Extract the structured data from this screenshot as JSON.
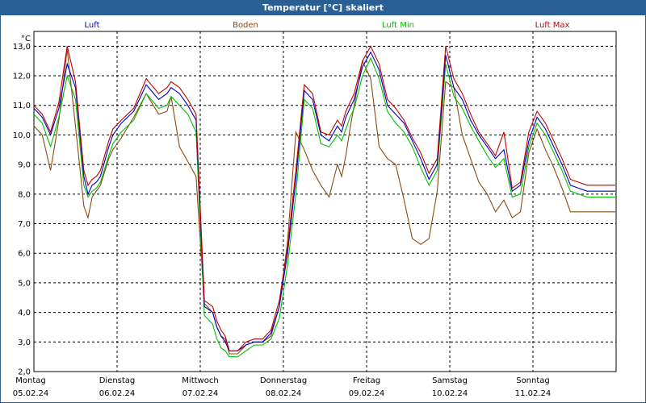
{
  "window": {
    "title": "Temperatur [°C] skaliert"
  },
  "colors": {
    "luft": "#0000c8",
    "boden": "#8b4a10",
    "luft_min": "#00c000",
    "luft_max": "#c00000",
    "titlebar": "#2a5f96",
    "grid": "#000000"
  },
  "chart_data": {
    "type": "line",
    "title": "Temperatur [°C] skaliert",
    "ylabel": "°C",
    "ylim": [
      2.0,
      13.5
    ],
    "yticks": [
      "2,0",
      "3,0",
      "4,0",
      "5,0",
      "6,0",
      "7,0",
      "8,0",
      "9,0",
      "10,0",
      "11,0",
      "12,0",
      "13,0"
    ],
    "x_unit": "days since Montag 05.02.24 00:00",
    "xlim": [
      0,
      7
    ],
    "x_ticks": [
      {
        "day": "Montag",
        "date": "05.02.24"
      },
      {
        "day": "Dienstag",
        "date": "06.02.24"
      },
      {
        "day": "Mittwoch",
        "date": "07.02.24"
      },
      {
        "day": "Donnerstag",
        "date": "08.02.24"
      },
      {
        "day": "Freitag",
        "date": "09.02.24"
      },
      {
        "day": "Samstag",
        "date": "10.02.24"
      },
      {
        "day": "Sonntag",
        "date": "11.02.24"
      }
    ],
    "grid": true,
    "legend": "top",
    "series": [
      {
        "name": "Luft",
        "x": [
          0,
          0.1,
          0.2,
          0.3,
          0.4,
          0.5,
          0.6,
          0.65,
          0.7,
          0.75,
          0.8,
          0.9,
          0.95,
          1.05,
          1.2,
          1.35,
          1.5,
          1.6,
          1.65,
          1.75,
          1.85,
          1.95,
          2.05,
          2.15,
          2.2,
          2.25,
          2.3,
          2.35,
          2.45,
          2.55,
          2.65,
          2.75,
          2.85,
          2.95,
          3.05,
          3.15,
          3.25,
          3.35,
          3.45,
          3.55,
          3.65,
          3.7,
          3.75,
          3.8,
          3.85,
          3.95,
          4.05,
          4.15,
          4.25,
          4.35,
          4.45,
          4.55,
          4.65,
          4.75,
          4.85,
          4.95,
          5.05,
          5.15,
          5.25,
          5.35,
          5.45,
          5.55,
          5.65,
          5.75,
          5.85,
          5.95,
          6.05,
          6.15,
          6.25,
          6.35,
          6.45,
          6.55,
          6.65,
          6.75,
          6.85,
          6.95,
          6.99
        ],
        "values": [
          10.9,
          10.6,
          10.0,
          10.9,
          12.4,
          11.6,
          8.6,
          8.0,
          8.3,
          8.4,
          8.6,
          9.6,
          10.0,
          10.4,
          10.8,
          11.7,
          11.2,
          11.4,
          11.6,
          11.4,
          11.0,
          10.5,
          4.2,
          4.0,
          3.5,
          3.2,
          3.0,
          2.7,
          2.7,
          2.9,
          3.0,
          3.0,
          3.3,
          4.2,
          6.0,
          8.5,
          11.5,
          11.2,
          10.0,
          9.8,
          10.3,
          10.1,
          10.6,
          10.9,
          11.2,
          12.3,
          12.8,
          12.2,
          11.0,
          10.7,
          10.4,
          9.8,
          9.2,
          8.5,
          9.0,
          12.7,
          11.6,
          11.2,
          10.5,
          10.0,
          9.6,
          9.2,
          9.5,
          8.1,
          8.3,
          9.8,
          10.6,
          10.2,
          9.6,
          9.0,
          8.3,
          8.2,
          8.1,
          8.1,
          8.1,
          8.1,
          8.1
        ]
      },
      {
        "name": "Boden",
        "x": [
          0,
          0.1,
          0.2,
          0.3,
          0.4,
          0.5,
          0.6,
          0.65,
          0.7,
          0.75,
          0.8,
          0.9,
          0.95,
          1.05,
          1.2,
          1.35,
          1.5,
          1.6,
          1.65,
          1.75,
          1.85,
          1.95,
          2.05,
          2.15,
          2.2,
          2.25,
          2.3,
          2.35,
          2.45,
          2.55,
          2.65,
          2.75,
          2.85,
          2.95,
          3.05,
          3.15,
          3.25,
          3.35,
          3.45,
          3.55,
          3.65,
          3.7,
          3.75,
          3.8,
          3.85,
          3.95,
          4.05,
          4.15,
          4.25,
          4.35,
          4.45,
          4.55,
          4.65,
          4.75,
          4.85,
          4.95,
          5.05,
          5.15,
          5.25,
          5.35,
          5.45,
          5.55,
          5.65,
          5.75,
          5.85,
          5.95,
          6.05,
          6.15,
          6.25,
          6.35,
          6.45,
          6.55,
          6.65,
          6.75,
          6.85,
          6.95,
          6.99
        ],
        "values": [
          10.3,
          10.0,
          8.8,
          10.5,
          12.9,
          10.3,
          7.6,
          7.2,
          7.9,
          8.1,
          8.3,
          9.2,
          9.5,
          9.9,
          10.6,
          11.4,
          10.7,
          10.8,
          11.3,
          9.6,
          9.1,
          8.6,
          4.3,
          4.0,
          3.5,
          3.2,
          3.1,
          2.6,
          2.6,
          2.9,
          3.0,
          3.0,
          3.2,
          4.2,
          6.4,
          10.1,
          9.5,
          8.8,
          8.3,
          7.9,
          9.0,
          8.6,
          9.3,
          10.2,
          11.0,
          12.5,
          11.9,
          9.6,
          9.2,
          9.0,
          7.8,
          6.5,
          6.3,
          6.5,
          8.1,
          11.8,
          11.6,
          10.0,
          9.2,
          8.4,
          8.0,
          7.4,
          7.8,
          7.2,
          7.4,
          9.4,
          10.2,
          9.5,
          8.9,
          8.2,
          7.4,
          7.4,
          7.4,
          7.4,
          7.4,
          7.4,
          7.4
        ]
      },
      {
        "name": "Luft Min",
        "x": [
          0,
          0.1,
          0.2,
          0.3,
          0.4,
          0.5,
          0.6,
          0.65,
          0.7,
          0.75,
          0.8,
          0.9,
          0.95,
          1.05,
          1.2,
          1.35,
          1.5,
          1.6,
          1.65,
          1.75,
          1.85,
          1.95,
          2.05,
          2.15,
          2.2,
          2.25,
          2.3,
          2.35,
          2.45,
          2.55,
          2.65,
          2.75,
          2.85,
          2.95,
          3.05,
          3.15,
          3.25,
          3.35,
          3.45,
          3.55,
          3.65,
          3.7,
          3.75,
          3.8,
          3.85,
          3.95,
          4.05,
          4.15,
          4.25,
          4.35,
          4.45,
          4.55,
          4.65,
          4.75,
          4.85,
          4.95,
          5.05,
          5.15,
          5.25,
          5.35,
          5.45,
          5.55,
          5.65,
          5.75,
          5.85,
          5.95,
          6.05,
          6.15,
          6.25,
          6.35,
          6.45,
          6.55,
          6.65,
          6.75,
          6.85,
          6.95,
          6.99
        ],
        "values": [
          10.7,
          10.4,
          9.6,
          10.6,
          12.0,
          11.2,
          8.3,
          7.9,
          8.1,
          8.2,
          8.4,
          9.3,
          9.7,
          10.1,
          10.5,
          11.4,
          10.9,
          11.0,
          11.3,
          11.0,
          10.7,
          10.1,
          3.9,
          3.6,
          3.1,
          2.8,
          2.7,
          2.5,
          2.5,
          2.7,
          2.9,
          2.9,
          3.1,
          3.8,
          5.6,
          8.0,
          11.2,
          10.9,
          9.7,
          9.6,
          10.0,
          9.8,
          10.2,
          10.6,
          10.9,
          12.0,
          12.6,
          11.9,
          10.8,
          10.4,
          10.1,
          9.6,
          8.9,
          8.3,
          8.8,
          12.4,
          11.3,
          10.9,
          10.3,
          9.8,
          9.3,
          8.9,
          9.2,
          7.9,
          8.0,
          9.6,
          10.4,
          10.0,
          9.4,
          8.8,
          8.1,
          8.0,
          7.9,
          7.9,
          7.9,
          7.9,
          7.9
        ]
      },
      {
        "name": "Luft Max",
        "x": [
          0,
          0.1,
          0.2,
          0.3,
          0.4,
          0.5,
          0.6,
          0.65,
          0.7,
          0.75,
          0.8,
          0.9,
          0.95,
          1.05,
          1.2,
          1.35,
          1.5,
          1.6,
          1.65,
          1.75,
          1.85,
          1.95,
          2.05,
          2.15,
          2.2,
          2.25,
          2.3,
          2.35,
          2.45,
          2.55,
          2.65,
          2.75,
          2.85,
          2.95,
          3.05,
          3.15,
          3.25,
          3.35,
          3.45,
          3.55,
          3.65,
          3.7,
          3.75,
          3.8,
          3.85,
          3.95,
          4.05,
          4.15,
          4.25,
          4.35,
          4.45,
          4.55,
          4.65,
          4.75,
          4.85,
          4.95,
          5.05,
          5.15,
          5.25,
          5.35,
          5.45,
          5.55,
          5.65,
          5.75,
          5.85,
          5.95,
          6.05,
          6.15,
          6.25,
          6.35,
          6.45,
          6.55,
          6.65,
          6.75,
          6.85,
          6.95,
          6.99
        ],
        "values": [
          11.0,
          10.7,
          10.1,
          11.1,
          13.0,
          11.8,
          8.8,
          8.3,
          8.5,
          8.6,
          8.8,
          9.8,
          10.2,
          10.5,
          10.9,
          11.9,
          11.4,
          11.6,
          11.8,
          11.6,
          11.2,
          10.7,
          4.4,
          4.2,
          3.7,
          3.4,
          3.2,
          2.7,
          2.7,
          3.0,
          3.1,
          3.1,
          3.4,
          4.4,
          6.2,
          8.8,
          11.7,
          11.4,
          10.1,
          10.0,
          10.5,
          10.3,
          10.8,
          11.1,
          11.4,
          12.5,
          13.0,
          12.4,
          11.2,
          10.9,
          10.5,
          9.9,
          9.4,
          8.7,
          9.2,
          13.0,
          11.9,
          11.4,
          10.7,
          10.1,
          9.7,
          9.3,
          10.1,
          8.2,
          8.4,
          10.1,
          10.8,
          10.4,
          9.8,
          9.2,
          8.5,
          8.4,
          8.3,
          8.3,
          8.3,
          8.3,
          8.3
        ]
      }
    ]
  }
}
